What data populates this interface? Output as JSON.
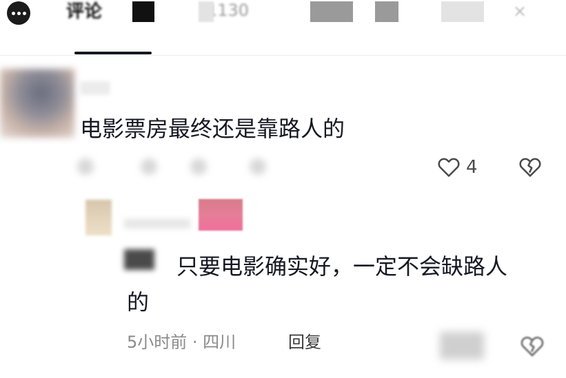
{
  "tabs": {
    "active_label": "评论",
    "count_label": "1130",
    "close_glyph": "×"
  },
  "comment": {
    "text": "电影票房最终还是靠路人的",
    "likes": "4"
  },
  "reply": {
    "text": "只要电影确实好，一定不会缺路人",
    "text_cont": "的",
    "time": "5小时前",
    "separator": " · ",
    "location": "四川",
    "reply_label": "回复"
  },
  "icons": {
    "menu": "more-icon",
    "like": "heart-outline-icon",
    "dislike": "broken-heart-icon"
  },
  "colors": {
    "text_primary": "#161823",
    "text_secondary": "#8a8a8a",
    "accent_pink": "#e57e98"
  }
}
